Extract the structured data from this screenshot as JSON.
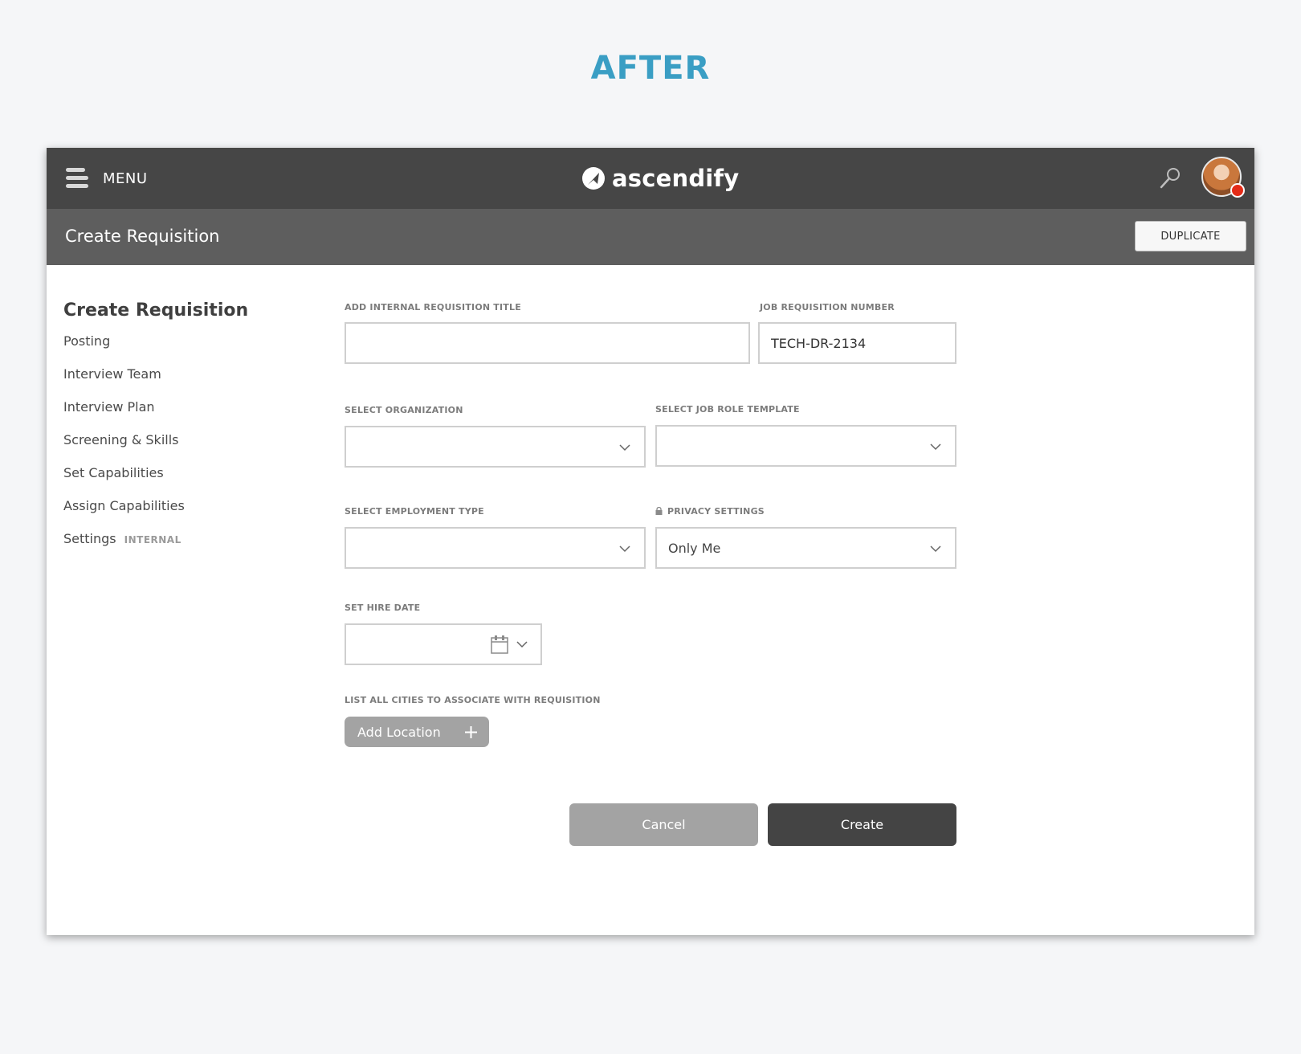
{
  "heading": "AFTER",
  "topbar": {
    "menu_label": "MENU",
    "brand": "ascendify"
  },
  "subbar": {
    "title": "Create Requisition",
    "duplicate_label": "DUPLICATE"
  },
  "sidenav": {
    "title": "Create Requisition",
    "items": [
      {
        "label": "Posting"
      },
      {
        "label": "Interview Team"
      },
      {
        "label": "Interview Plan"
      },
      {
        "label": "Screening & Skills"
      },
      {
        "label": "Set Capabilities"
      },
      {
        "label": "Assign Capabilities"
      },
      {
        "label": "Settings",
        "badge": "INTERNAL"
      }
    ]
  },
  "form": {
    "title_label": "ADD INTERNAL REQUISITION TITLE",
    "title_value": "",
    "req_number_label": "JOB REQUISITION NUMBER",
    "req_number_value": "TECH-DR-2134",
    "organization_label": "SELECT ORGANIZATION",
    "organization_value": "",
    "job_role_label": "SELECT JOB ROLE TEMPLATE",
    "job_role_value": "",
    "employment_label": "SELECT EMPLOYMENT TYPE",
    "employment_value": "",
    "privacy_label": "PRIVACY SETTINGS",
    "privacy_value": "Only Me",
    "hire_date_label": "SET HIRE DATE",
    "hire_date_value": "",
    "cities_label": "LIST ALL CITIES TO ASSOCIATE WITH REQUISITION",
    "add_location_label": "Add Location"
  },
  "actions": {
    "cancel_label": "Cancel",
    "create_label": "Create"
  },
  "colors": {
    "heading": "#3a9ec4",
    "topbar": "#464646",
    "subbar": "#5e5e5e",
    "primary_button": "#444444",
    "secondary_button": "#a3a3a3",
    "notification_dot": "#e42c18"
  }
}
